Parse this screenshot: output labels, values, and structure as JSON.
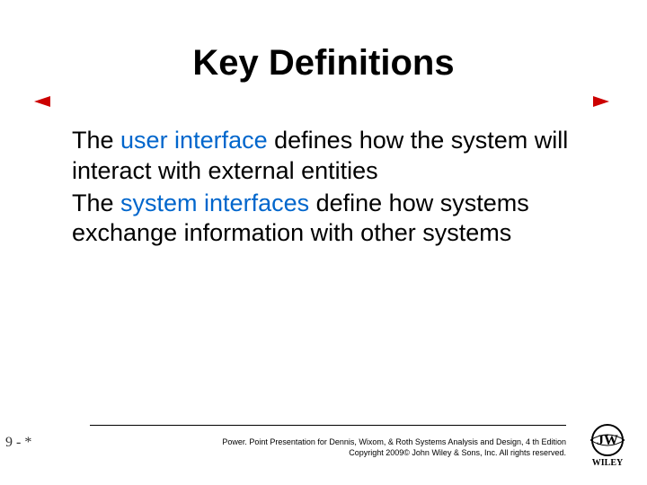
{
  "title": "Key Definitions",
  "body": {
    "p1": {
      "pre": "The ",
      "link": "user interface",
      "post": " defines how the system will interact with external entities"
    },
    "p2": {
      "pre": "The ",
      "link": "system interfaces",
      "post": " define how systems exchange information with other systems"
    }
  },
  "footer": {
    "line1": "Power. Point Presentation for Dennis, Wixom, & Roth Systems Analysis and Design, 4 th Edition",
    "line2": "Copyright 2009© John Wiley & Sons, Inc. All rights reserved."
  },
  "page_number": "9 - *",
  "logo_text": "WILEY"
}
